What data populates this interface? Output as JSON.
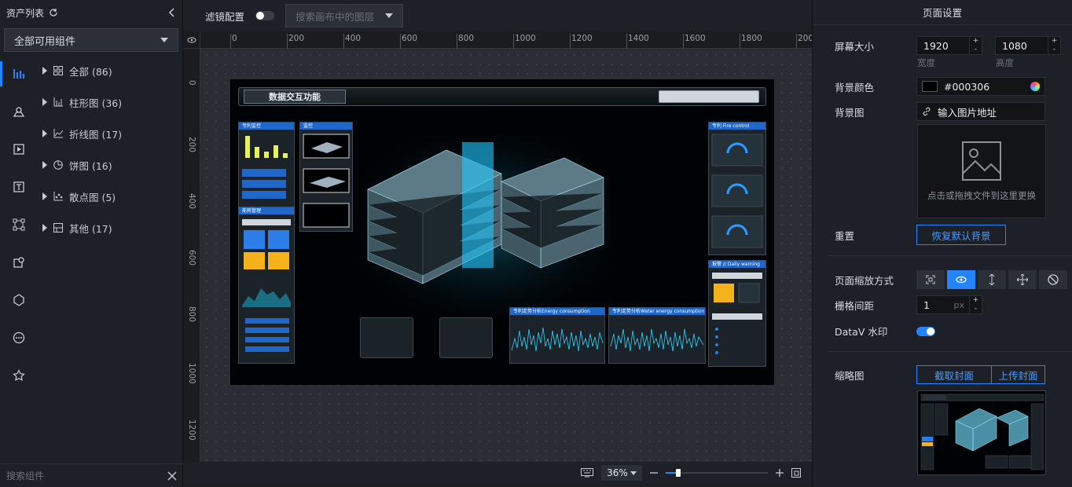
{
  "left_panel": {
    "title": "资产列表",
    "category_select": "全部可用组件",
    "tree": [
      {
        "label": "全部 (86)",
        "icon": "grid-icon"
      },
      {
        "label": "柱形图 (36)",
        "icon": "bar-chart-icon"
      },
      {
        "label": "折线图 (17)",
        "icon": "line-chart-icon"
      },
      {
        "label": "饼图 (16)",
        "icon": "pie-chart-icon"
      },
      {
        "label": "散点图 (5)",
        "icon": "scatter-icon"
      },
      {
        "label": "其他 (17)",
        "icon": "other-icon"
      }
    ],
    "search_placeholder": "搜索组件"
  },
  "toolbar": {
    "filter_label": "滤镜配置",
    "layer_search_placeholder": "搜索画布中的图层"
  },
  "ruler": {
    "top": [
      "0",
      "200",
      "400",
      "600",
      "800",
      "1000",
      "1200",
      "1400",
      "1600",
      "1800",
      "200"
    ],
    "left": [
      "0",
      "200",
      "400",
      "600",
      "800",
      "1000",
      "1200"
    ]
  },
  "screen_preview": {
    "title": "数据交互功能",
    "panel_labels": {
      "p1": "专利监控",
      "p2": "监控",
      "p3": "能耗管理",
      "p4": "专利  Fire control",
      "p5": "报警 // Daily warning",
      "c1": "专利走势分析Energy consumption",
      "c2": "专利走势分析Water energy consumption"
    }
  },
  "bottom_bar": {
    "zoom": "36%"
  },
  "right_panel": {
    "title": "页面设置",
    "screen_size_label": "屏幕大小",
    "width_value": "1920",
    "height_value": "1080",
    "width_caption": "宽度",
    "height_caption": "高度",
    "bg_color_label": "背景颜色",
    "bg_color_value": "#000306",
    "bg_image_label": "背景图",
    "bg_image_input": "输入图片地址",
    "upload_hint": "点击或拖拽文件到这里更换",
    "reset_label": "重置",
    "reset_button": "恢复默认背景",
    "scale_mode_label": "页面缩放方式",
    "grid_label": "栅格间距",
    "grid_value": "1",
    "grid_unit": "px",
    "watermark_label": "DataV 水印",
    "thumbnail_label": "缩略图",
    "capture_button": "截取封面",
    "upload_cover_button": "上传封面"
  }
}
